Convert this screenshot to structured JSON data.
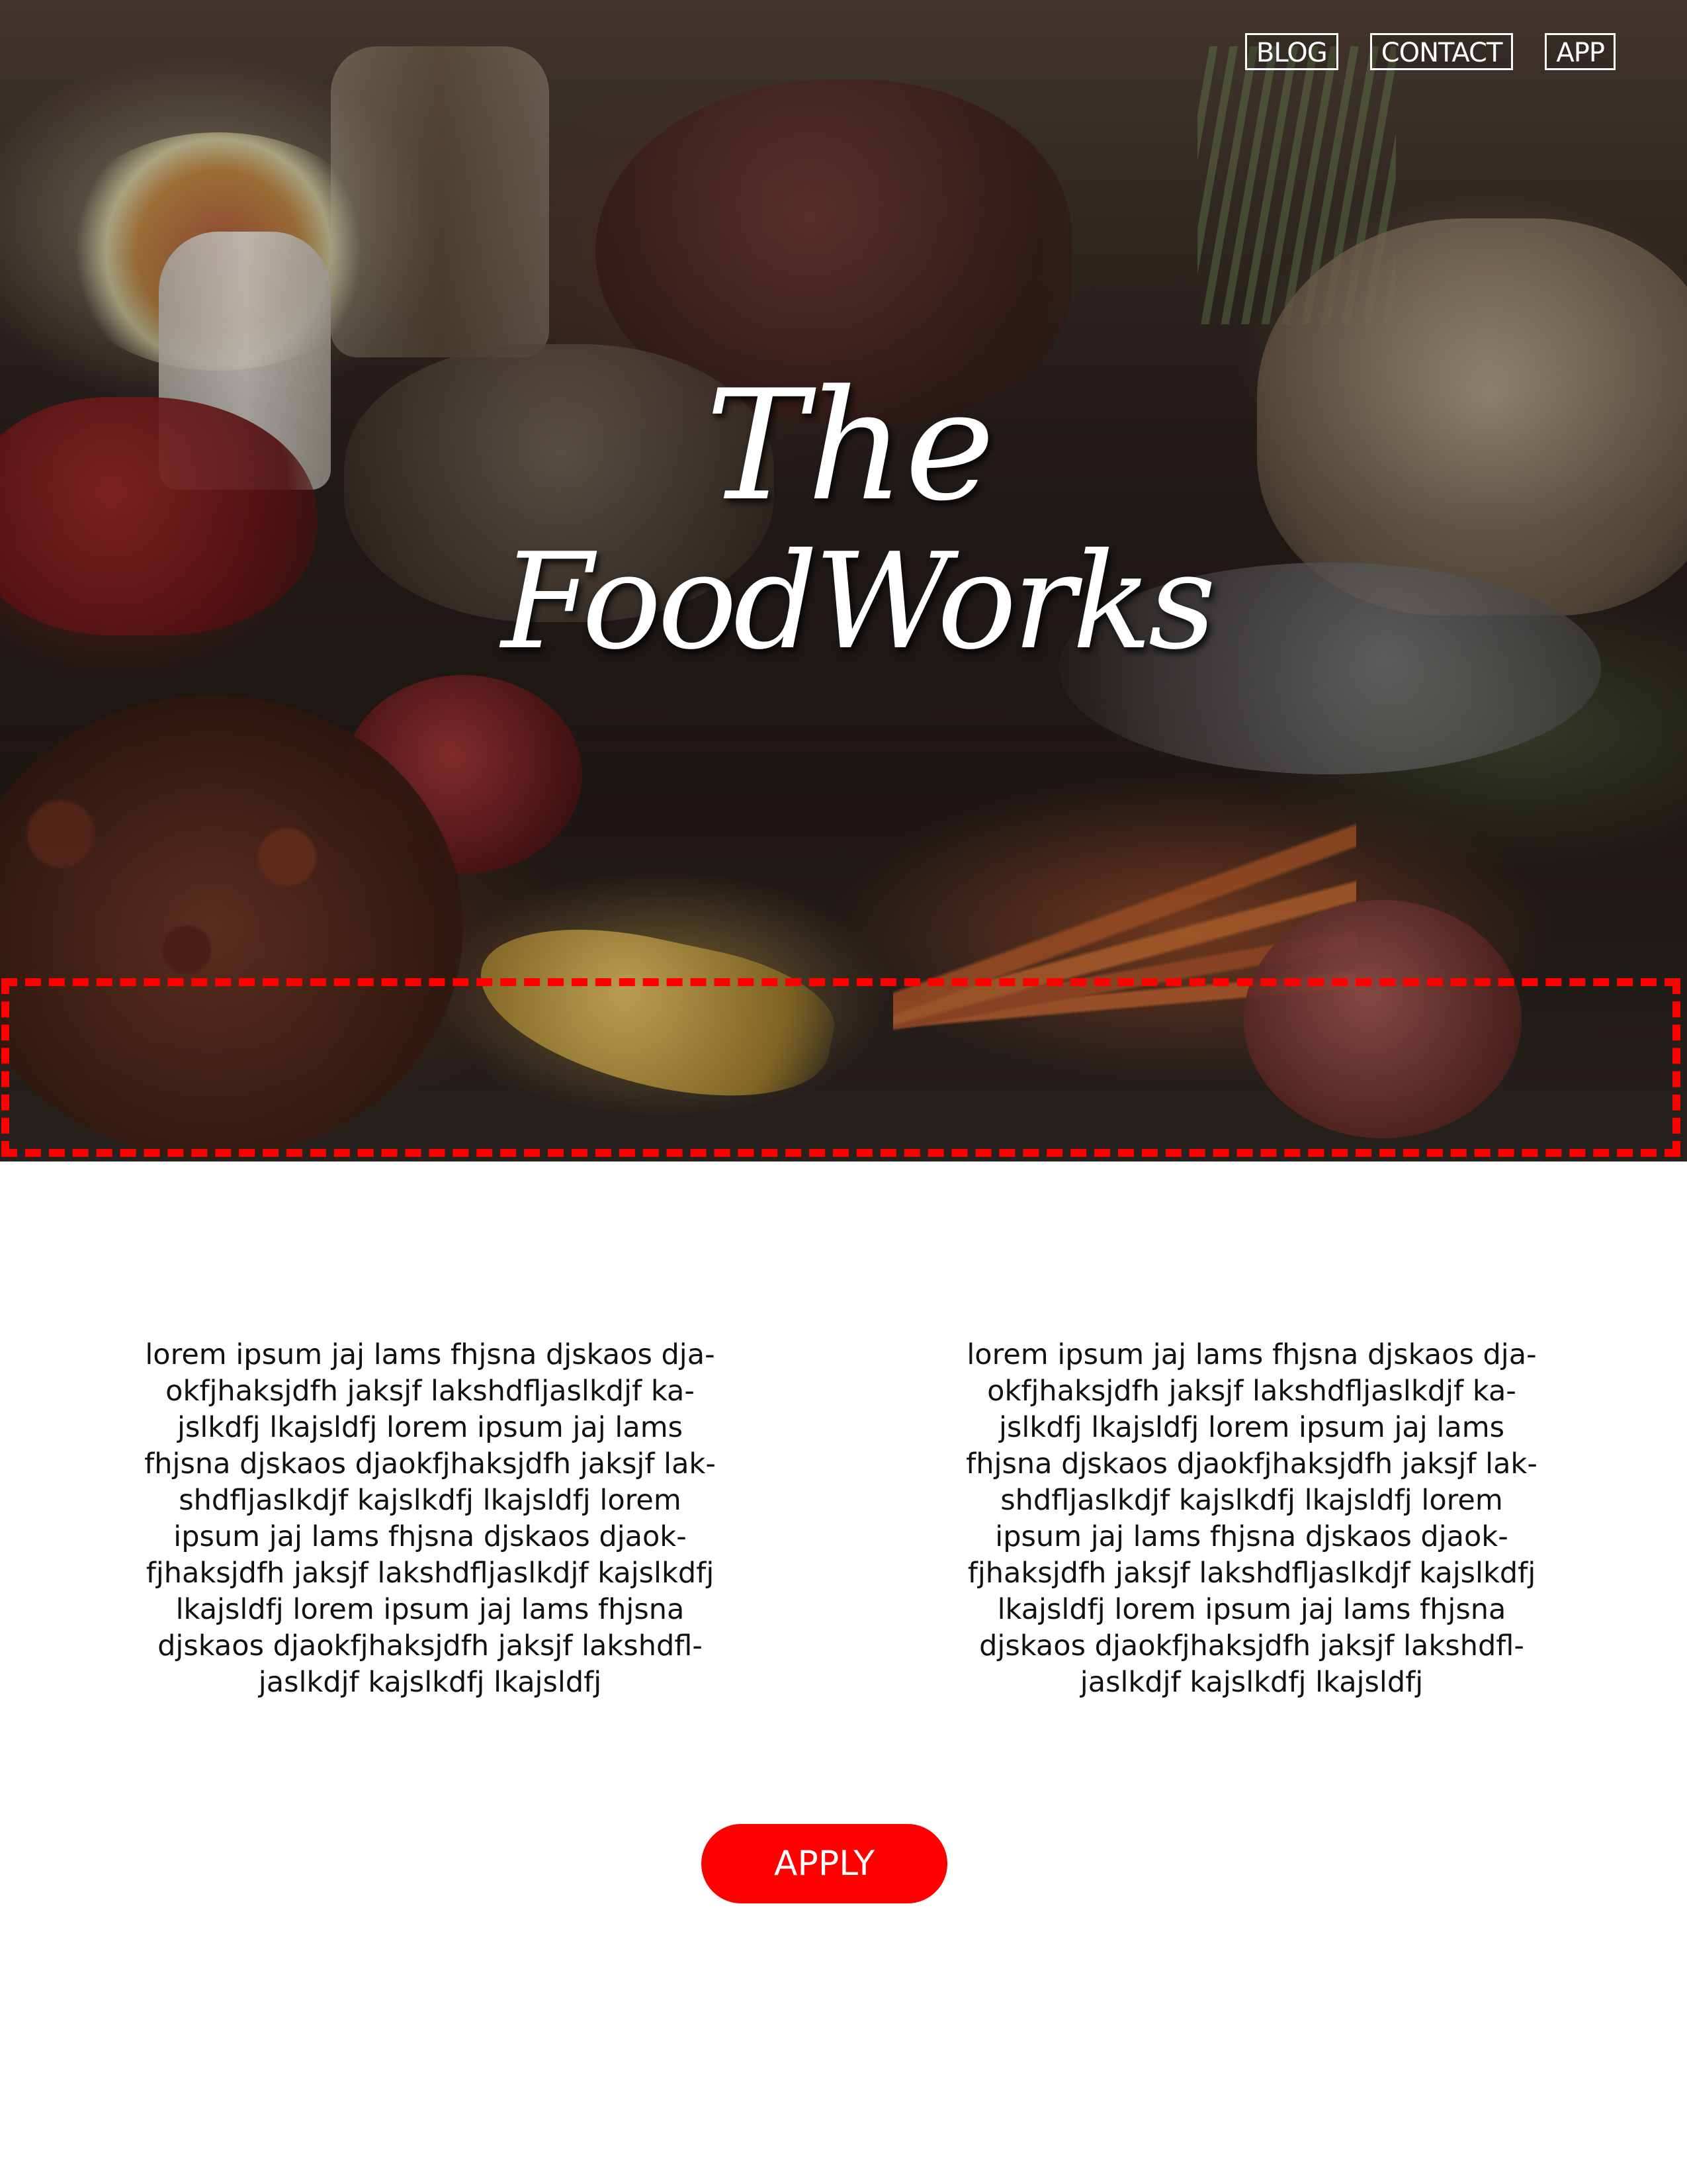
{
  "nav": {
    "items": [
      {
        "label": "BLOG"
      },
      {
        "label": "CONTACT"
      },
      {
        "label": "APP"
      }
    ]
  },
  "hero": {
    "title_line1": "The",
    "title_line2": "FoodWorks"
  },
  "content": {
    "columns": [
      {
        "text": "lorem ipsum jaj lams fhjsna djskaos dja-okfjhaksjdfh jaksjf lakshdfljaslkdjf ka-jslkdfj lkajsldfj  lorem ipsum jaj lams fhjsna djskaos djaokfjhaksjdfh jaksjf lak-shdfljaslkdjf kajslkdfj lkajsldfj  lorem ipsum jaj lams fhjsna djskaos djaok-fjhaksjdfh jaksjf lakshdfljaslkdjf kajslkdfj lkajsldfj  lorem ipsum jaj lams fhjsna djskaos djaokfjhaksjdfh jaksjf lakshdfl-jaslkdjf kajslkdfj lkajsldfj"
      },
      {
        "text": "lorem ipsum jaj lams fhjsna djskaos dja-okfjhaksjdfh jaksjf lakshdfljaslkdjf ka-jslkdfj lkajsldfj  lorem ipsum jaj lams fhjsna djskaos djaokfjhaksjdfh jaksjf lak-shdfljaslkdjf kajslkdfj lkajsldfj  lorem ipsum jaj lams fhjsna djskaos djaok-fjhaksjdfh jaksjf lakshdfljaslkdjf kajslkdfj lkajsldfj  lorem ipsum jaj lams fhjsna djskaos djaokfjhaksjdfh jaksjf lakshdfl-jaslkdjf kajslkdfj lkajsldfj"
      }
    ]
  },
  "apply": {
    "label": "APPLY"
  },
  "colors": {
    "accent": "#ff0000",
    "text": "#111111",
    "background": "#ffffff"
  }
}
